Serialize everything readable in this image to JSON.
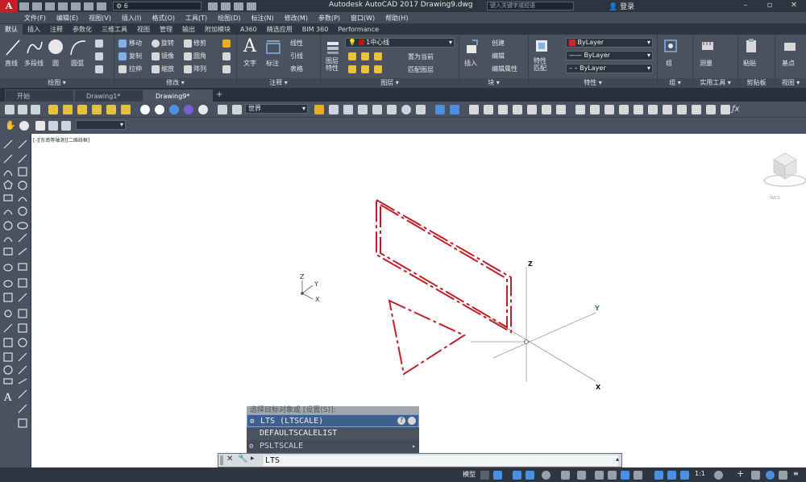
{
  "app": {
    "logo_letter": "A",
    "title": "Autodesk AutoCAD 2017    Drawing9.dwg",
    "workspace_value": "6",
    "search_placeholder": "键入关键字或短语",
    "login_label": "登录"
  },
  "menu": [
    "文件(F)",
    "编辑(E)",
    "视图(V)",
    "插入(I)",
    "格式(O)",
    "工具(T)",
    "绘图(D)",
    "标注(N)",
    "修改(M)",
    "参数(P)",
    "窗口(W)",
    "帮助(H)"
  ],
  "ribbon_tabs": [
    "默认",
    "插入",
    "注释",
    "参数化",
    "三维工具",
    "视图",
    "管理",
    "输出",
    "附加模块",
    "A360",
    "精选应用",
    "BIM 360",
    "Performance"
  ],
  "panels": {
    "draw": {
      "title": "绘图",
      "line": "直线",
      "polyline": "多段线",
      "circle": "圆",
      "arc": "圆弧"
    },
    "modify": {
      "title": "修改",
      "move": "移动",
      "rotate": "旋转",
      "trim": "修剪",
      "copy": "复制",
      "mirror": "镜像",
      "fillet": "圆角",
      "stretch": "拉伸",
      "scale": "缩放",
      "array": "阵列"
    },
    "annotation": {
      "title": "注释",
      "text": "文字",
      "dimension": "标注",
      "leader": "引线",
      "table": "表格",
      "linear": "线性"
    },
    "layers": {
      "title": "图层",
      "properties": "图层\n特性",
      "current_layer": "1中心线",
      "make_current": "置为当前",
      "match_layer": "匹配图层"
    },
    "block": {
      "title": "块",
      "insert": "插入",
      "create": "创建",
      "edit": "编辑",
      "edit_attr": "编辑属性"
    },
    "properties": {
      "title": "特性",
      "match": "特性\n匹配",
      "color": "ByLayer",
      "lineweight": "ByLayer",
      "linetype": "ByLayer"
    },
    "groups": {
      "title": "组",
      "group": "组"
    },
    "utilities": {
      "title": "实用工具",
      "measure": "测量"
    },
    "clipboard": {
      "title": "剪贴板",
      "paste": "粘贴"
    },
    "view": {
      "title": "视图",
      "base": "基点"
    }
  },
  "file_tabs": [
    "开始",
    "Drawing1*",
    "Drawing9*"
  ],
  "toolbar": {
    "ucs_value": "世界"
  },
  "viewport": {
    "label": "[-][东南等轴测][二维线框]",
    "ucs_z": "Z",
    "ucs_y": "Y",
    "ucs_x": "X",
    "axis_z": "Z",
    "axis_y": "Y",
    "axis_x": "X",
    "viewcube_label": "WCS"
  },
  "command": {
    "prompt": "选择目标对象或 [设置(S)]:",
    "suggestions": [
      "LTS (LTSCALE)",
      "DEFAULTSCALELIST",
      "PSLTSCALE"
    ],
    "input_value": "LTS"
  },
  "status": {
    "model": "模型",
    "scale": "1:1"
  },
  "colors": {
    "drawing_red": "#c0202a",
    "canvas_bg": "#ffffff",
    "ui_bg": "#4a5262"
  }
}
